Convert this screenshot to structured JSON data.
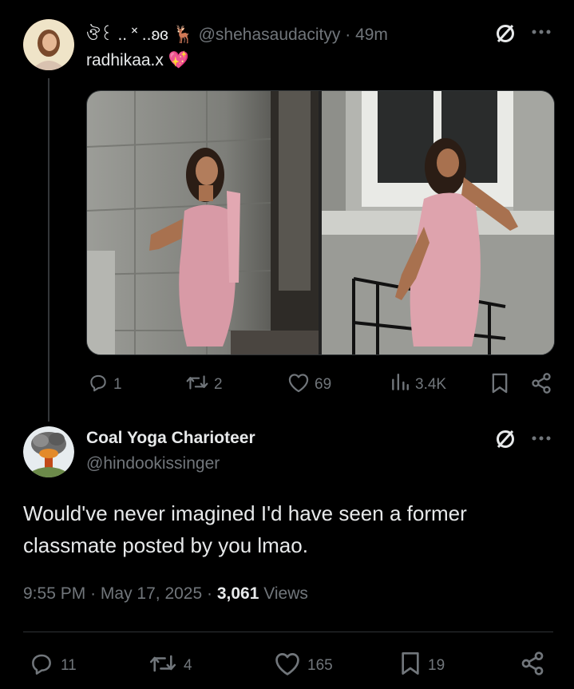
{
  "parent_tweet": {
    "display_name": "ঔ꒰ .. ˟ ..ʚɞ 🦌",
    "handle": "@shehasaudacityy",
    "separator": "·",
    "time": "49m",
    "text": "radhikaa.x",
    "text_emoji": "💖",
    "actions": {
      "replies": "1",
      "reposts": "2",
      "likes": "69",
      "views": "3.4K"
    }
  },
  "reply_tweet": {
    "display_name": "Coal Yoga Charioteer",
    "handle": "@hindookissinger",
    "text": "Would've never imagined I'd have seen a former classmate posted by you lmao.",
    "timestamp_time": "9:55 PM",
    "timestamp_sep1": "·",
    "timestamp_date": "May 17, 2025",
    "timestamp_sep2": "·",
    "views_count": "3,061",
    "views_label": "Views",
    "actions": {
      "replies": "11",
      "reposts": "4",
      "likes": "165",
      "bookmarks": "19"
    }
  },
  "colors": {
    "background": "#000000",
    "text": "#e7e9ea",
    "muted": "#71767b",
    "divider": "#2f3336",
    "thread_line": "#333639"
  }
}
